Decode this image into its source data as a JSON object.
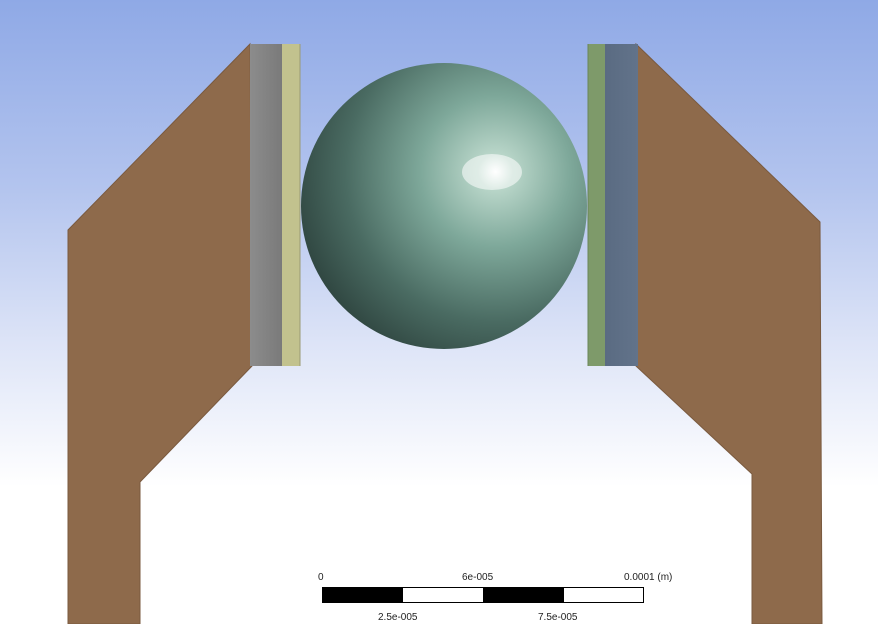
{
  "viewport": {
    "description_colors": {
      "bg_top": "#8fa9e6",
      "bg_bottom": "#ffffff",
      "arm_left": "#8e6a4b",
      "arm_right": "#8e6a4b",
      "plate_left_outer": "#858585",
      "plate_left_inner": "#c2c28e",
      "plate_right_inner": "#7e9a6a",
      "plate_right_outer": "#5e6f86",
      "sphere_dark": "#2f4640",
      "sphere_light": "#8fb8a8",
      "highlight": "#ffffff"
    }
  },
  "scale_bar": {
    "top_labels": [
      "0",
      "6e-005",
      "0.0001 (m)"
    ],
    "bottom_labels": [
      "2.5e-005",
      "7.5e-005"
    ],
    "unit": "(m)"
  }
}
